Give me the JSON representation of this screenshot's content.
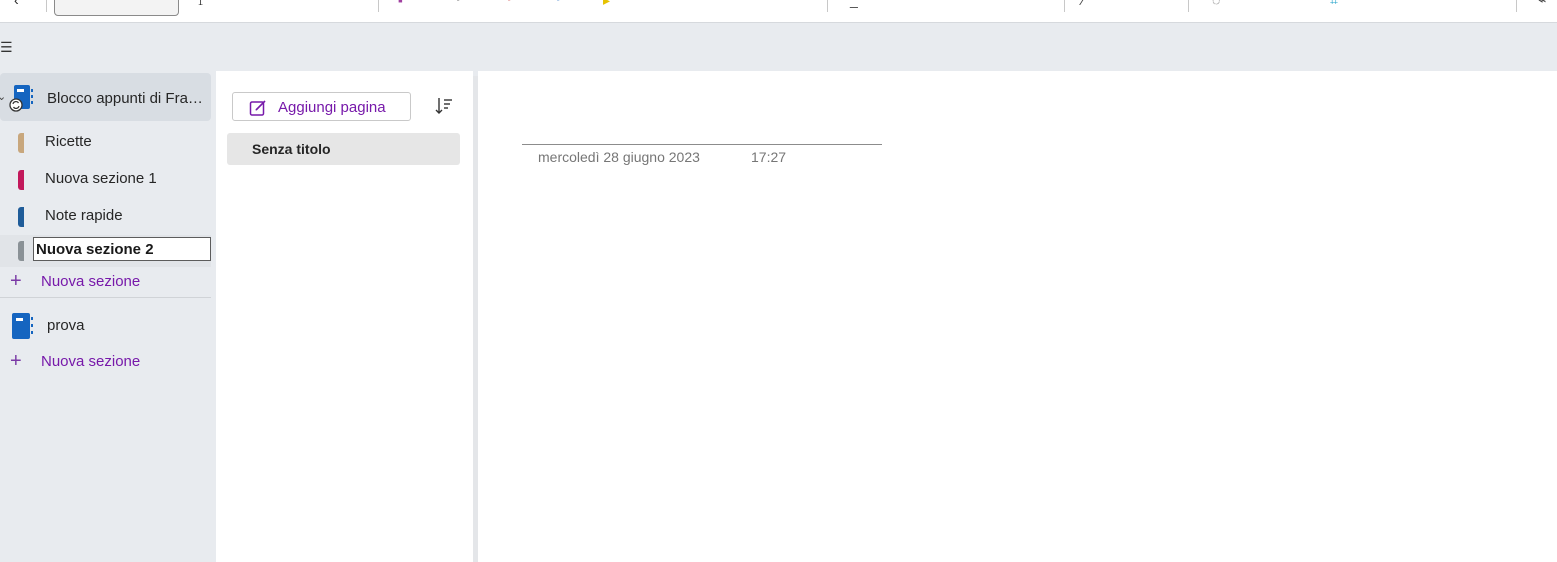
{
  "notebooks": [
    {
      "name": "Blocco appunti di Francesca",
      "display_name": "Blocco appunti di Fran...",
      "sections": [
        {
          "label": "Ricette",
          "color": "#c8a77d"
        },
        {
          "label": "Nuova sezione 1",
          "color": "#c2185b"
        },
        {
          "label": "Note rapide",
          "color": "#1f5c99"
        },
        {
          "label": "Nuova sezione 2",
          "color": "#8a9196",
          "editing": true
        }
      ],
      "add_section_label": "Nuova sezione"
    },
    {
      "display_name": "prova",
      "sections": [],
      "add_section_label": "Nuova sezione"
    }
  ],
  "page_list": {
    "add_page_label": "Aggiungi pagina",
    "pages": [
      {
        "title": "Senza titolo",
        "selected": true
      }
    ]
  },
  "page": {
    "date": "mercoledì 28 giugno 2023",
    "time": "17:27"
  },
  "colors": {
    "accent": "#7719aa",
    "notebook_blue": "#1565c0"
  }
}
